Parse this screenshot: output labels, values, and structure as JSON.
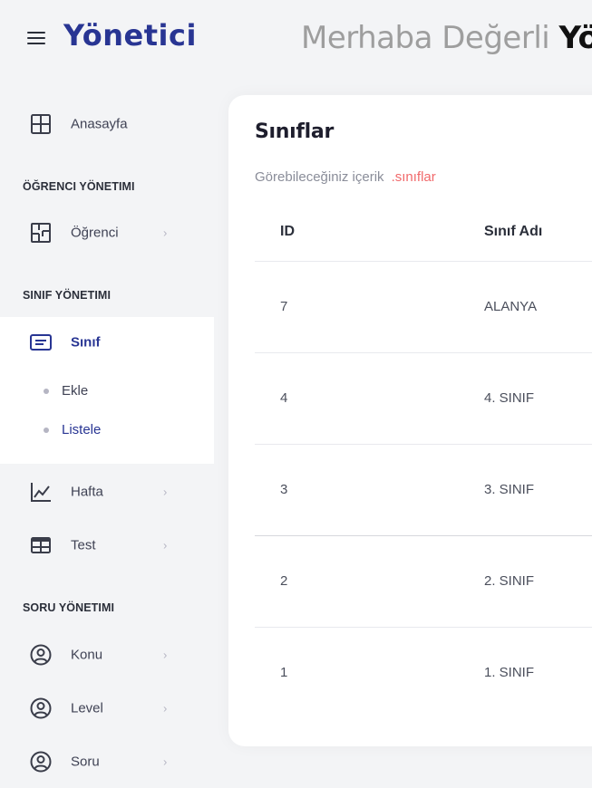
{
  "header": {
    "brand": "Yönetici",
    "greeting_prefix": "Merhaba Değerli",
    "greeting_name": "Yön"
  },
  "sidebar": {
    "dashboard": {
      "label": "Anasayfa",
      "icon": "grid-icon"
    },
    "sections": [
      {
        "title": "ÖĞRENCI YÖNETIMI"
      },
      {
        "title": "SINIF YÖNETIMI"
      },
      {
        "title": "SORU YÖNETIMI"
      }
    ],
    "items": [
      {
        "label": "Öğrenci",
        "icon": "floorplan-icon"
      },
      {
        "label": "Sınıf",
        "icon": "list-icon"
      },
      {
        "label": "Hafta",
        "icon": "chart-line-icon"
      },
      {
        "label": "Test",
        "icon": "table-icon"
      },
      {
        "label": "Konu",
        "icon": "user-circle-icon"
      },
      {
        "label": "Level",
        "icon": "user-circle-icon"
      },
      {
        "label": "Soru",
        "icon": "user-circle-icon"
      }
    ],
    "sub_items": [
      {
        "label": "Ekle"
      },
      {
        "label": "Listele"
      }
    ],
    "chevron": "›"
  },
  "content": {
    "title": "Sınıflar",
    "subtitle": "Görebileceğiniz içerik",
    "subtitle_tag": ".sınıflar",
    "table": {
      "headers": [
        "ID",
        "Sınıf Adı"
      ],
      "rows": [
        {
          "id": "7",
          "name": "ALANYA"
        },
        {
          "id": "4",
          "name": "4. SINIF"
        },
        {
          "id": "3",
          "name": "3. SINIF"
        },
        {
          "id": "2",
          "name": "2. SINIF"
        },
        {
          "id": "1",
          "name": "1. SINIF"
        }
      ]
    }
  },
  "colors": {
    "brand": "#283593",
    "accent_red": "#f1696b",
    "background": "#f3f4f6"
  }
}
